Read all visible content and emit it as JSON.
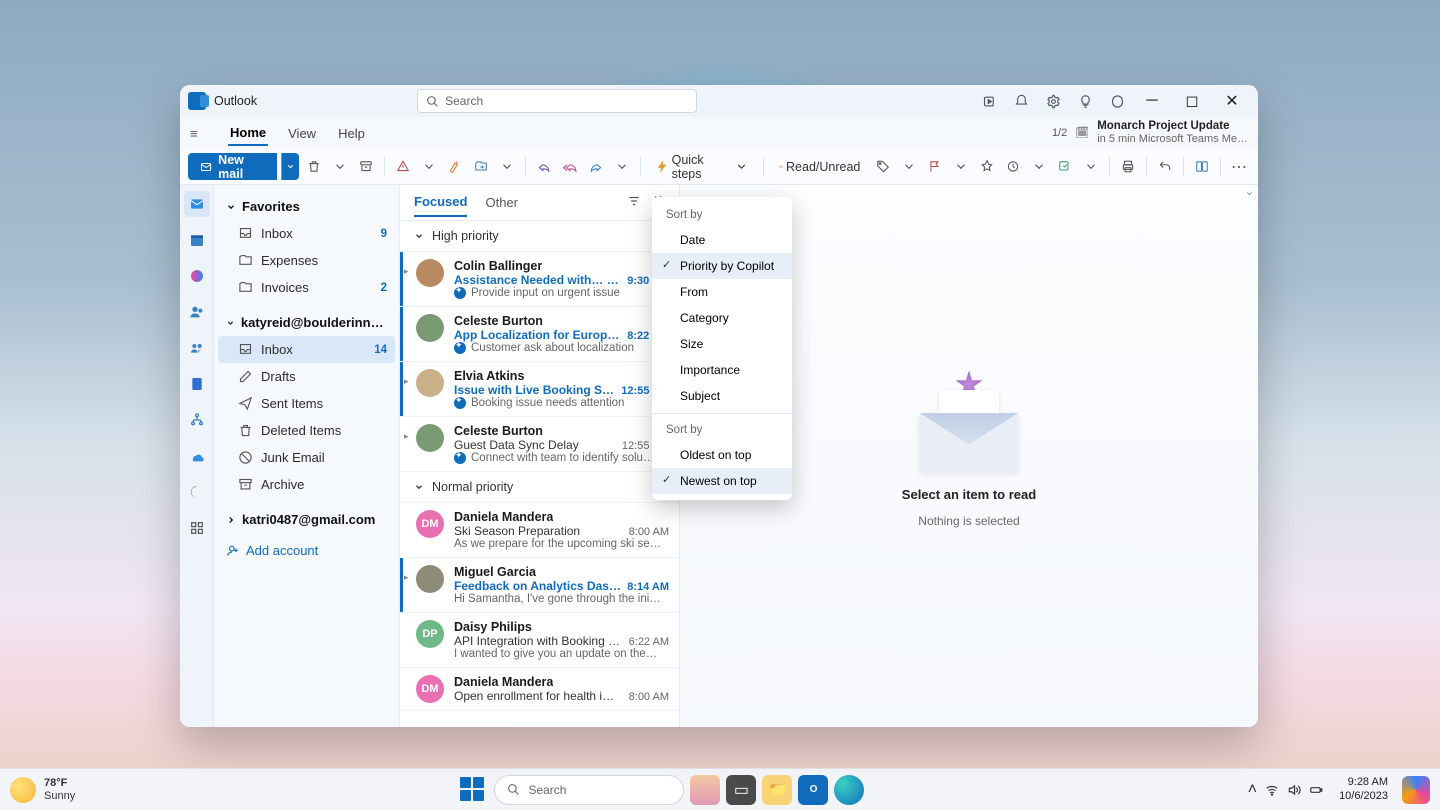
{
  "app": {
    "title": "Outlook",
    "search_placeholder": "Search"
  },
  "titlebar_icons": [
    "note",
    "bell",
    "settings",
    "lightbulb",
    "copilot"
  ],
  "tabs": {
    "items": [
      "Home",
      "View",
      "Help"
    ],
    "active": 0,
    "pager": "1/2",
    "reminder_title": "Monarch Project Update",
    "reminder_sub": "in 5 min Microsoft Teams Me…"
  },
  "toolbar": {
    "new_mail": "New mail",
    "quick_steps": "Quick steps",
    "read_unread": "Read/Unread"
  },
  "rail": [
    "mail",
    "calendar",
    "people",
    "files",
    "todo",
    "people2",
    "word",
    "org",
    "onedrive",
    "loop",
    "apps"
  ],
  "folders": {
    "favorites": "Favorites",
    "fav_items": [
      {
        "icon": "inbox",
        "label": "Inbox",
        "count": "9"
      },
      {
        "icon": "folder",
        "label": "Expenses",
        "count": ""
      },
      {
        "icon": "folder",
        "label": "Invoices",
        "count": "2"
      }
    ],
    "account1": "katyreid@boulderinnova…",
    "acct_items": [
      {
        "icon": "inbox",
        "label": "Inbox",
        "count": "14",
        "sel": true
      },
      {
        "icon": "drafts",
        "label": "Drafts"
      },
      {
        "icon": "sent",
        "label": "Sent Items"
      },
      {
        "icon": "trash",
        "label": "Deleted Items"
      },
      {
        "icon": "junk",
        "label": "Junk Email"
      },
      {
        "icon": "archive",
        "label": "Archive"
      }
    ],
    "account2": "katri0487@gmail.com",
    "add_account": "Add account"
  },
  "mlist": {
    "tabs": [
      "Focused",
      "Other"
    ],
    "group_high": "High priority",
    "group_normal": "Normal priority",
    "high": [
      {
        "from": "Colin Ballinger",
        "subj": "Assistance Needed with…  (2)",
        "time": "9:30 AM",
        "sum": "Provide input on urgent issue",
        "unread": true,
        "exp": true,
        "at": true,
        "av": "#b98a62"
      },
      {
        "from": "Celeste Burton",
        "subj": "App Localization for Europ…",
        "time": "8:22 AM",
        "sum": "Customer ask about localization",
        "unread": true,
        "av": "#7a9a74"
      },
      {
        "from": "Elvia Atkins",
        "subj": "Issue with Live Booking Syste…",
        "time": "12:55 PM",
        "sum": "Booking issue needs attention",
        "unread": true,
        "exp": true,
        "av": "#c9b089"
      },
      {
        "from": "Celeste Burton",
        "subj": "Guest Data Sync Delay",
        "time": "12:55 PM",
        "sum": "Connect with team to identify solu…",
        "unread": false,
        "exp": true,
        "av": "#7a9a74"
      }
    ],
    "normal": [
      {
        "from": "Daniela Mandera",
        "subj": "Ski Season Preparation",
        "time": "8:00 AM",
        "sum": "As we prepare for the upcoming ski se…",
        "av": "#e86fb0",
        "init": "DM"
      },
      {
        "from": "Miguel Garcia",
        "subj": "Feedback on Analytics Dash…",
        "time": "8:14 AM",
        "sum": "Hi Samantha, I've gone through the ini…",
        "unread": true,
        "exp": true,
        "av": "#8c8c78"
      },
      {
        "from": "Daisy Philips",
        "subj": "API Integration with Booking Sy…",
        "time": "6:22 AM",
        "sum": "I wanted to give you an update on the…",
        "av": "#6fb88a",
        "init": "DP"
      },
      {
        "from": "Daniela Mandera",
        "subj": "Open enrollment for health i…",
        "time": "8:00 AM",
        "sum": "",
        "av": "#e86fb0",
        "init": "DM"
      }
    ]
  },
  "sortmenu": {
    "h1": "Sort by",
    "items1": [
      "Date",
      "Priority by Copilot",
      "From",
      "Category",
      "Size",
      "Importance",
      "Subject"
    ],
    "sel1": 1,
    "h2": "Sort by",
    "items2": [
      "Oldest on top",
      "Newest on top"
    ],
    "sel2": 1
  },
  "reading": {
    "t1": "Select an item to read",
    "t2": "Nothing is selected"
  },
  "taskbar": {
    "temp": "78°F",
    "cond": "Sunny",
    "search": "Search",
    "time": "9:28 AM",
    "date": "10/6/2023"
  }
}
